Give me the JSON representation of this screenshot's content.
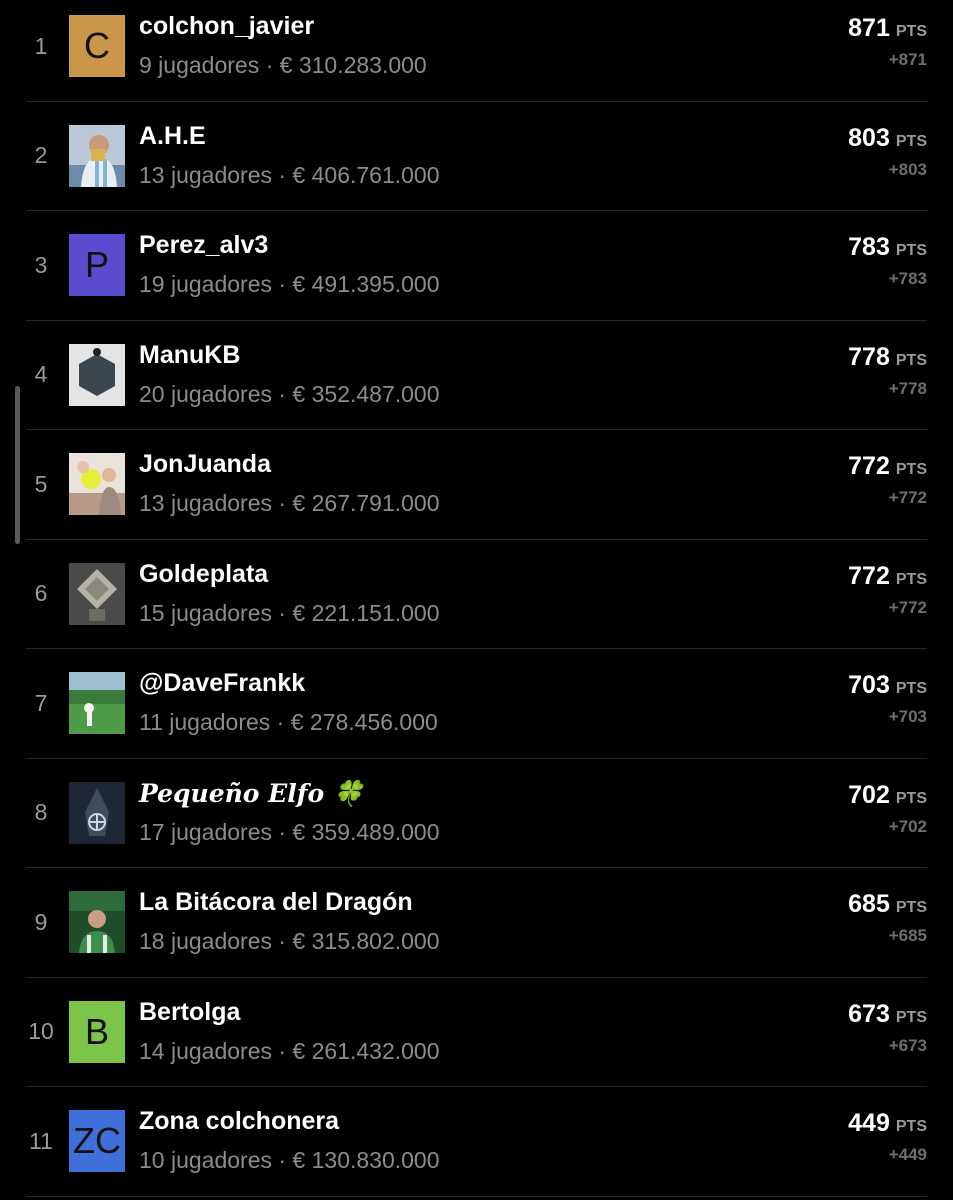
{
  "rows": [
    {
      "rank": "1",
      "avatar_letter": "C",
      "avatar_color": "#c9964a",
      "name": "colchon_javier",
      "sub": "9 jugadores · € 310.283.000",
      "points": "871",
      "unit": "PTS",
      "delta": "+871"
    },
    {
      "rank": "2",
      "avatar_icon": "player-photo-icon",
      "name": "A.H.E",
      "sub": "13 jugadores · € 406.761.000",
      "points": "803",
      "unit": "PTS",
      "delta": "+803"
    },
    {
      "rank": "3",
      "avatar_letter": "P",
      "avatar_color": "#5b4ccf",
      "name": "Perez_alv3",
      "sub": "19 jugadores · € 491.395.000",
      "points": "783",
      "unit": "PTS",
      "delta": "+783"
    },
    {
      "rank": "4",
      "avatar_icon": "manukb-logo-icon",
      "name": "ManuKB",
      "sub": "20 jugadores · € 352.487.000",
      "points": "778",
      "unit": "PTS",
      "delta": "+778"
    },
    {
      "rank": "5",
      "avatar_icon": "family-photo-icon",
      "name": "JonJuanda",
      "sub": "13 jugadores · € 267.791.000",
      "points": "772",
      "unit": "PTS",
      "delta": "+772"
    },
    {
      "rank": "6",
      "avatar_icon": "trophy-photo-icon",
      "name": "Goldeplata",
      "sub": "15 jugadores · € 221.151.000",
      "points": "772",
      "unit": "PTS",
      "delta": "+772"
    },
    {
      "rank": "7",
      "avatar_icon": "football-field-photo-icon",
      "name": "@DaveFrankk",
      "sub": "11 jugadores · € 278.456.000",
      "points": "703",
      "unit": "PTS",
      "delta": "+703"
    },
    {
      "rank": "8",
      "avatar_icon": "elf-emblem-icon",
      "name": "Pequeño Elfo 🍀",
      "sub": "17 jugadores · € 359.489.000",
      "points": "702",
      "unit": "PTS",
      "delta": "+702"
    },
    {
      "rank": "9",
      "avatar_icon": "dragon-player-photo-icon",
      "name": "La Bitácora del Dragón",
      "sub": "18 jugadores · € 315.802.000",
      "points": "685",
      "unit": "PTS",
      "delta": "+685"
    },
    {
      "rank": "10",
      "avatar_letter": "B",
      "avatar_color": "#7cc44a",
      "name": "Bertolga",
      "sub": "14 jugadores · € 261.432.000",
      "points": "673",
      "unit": "PTS",
      "delta": "+673"
    },
    {
      "rank": "11",
      "avatar_letter": "ZC",
      "avatar_color": "#3f6fd8",
      "name": "Zona colchonera",
      "sub": "10 jugadores · € 130.830.000",
      "points": "449",
      "unit": "PTS",
      "delta": "+449"
    }
  ]
}
